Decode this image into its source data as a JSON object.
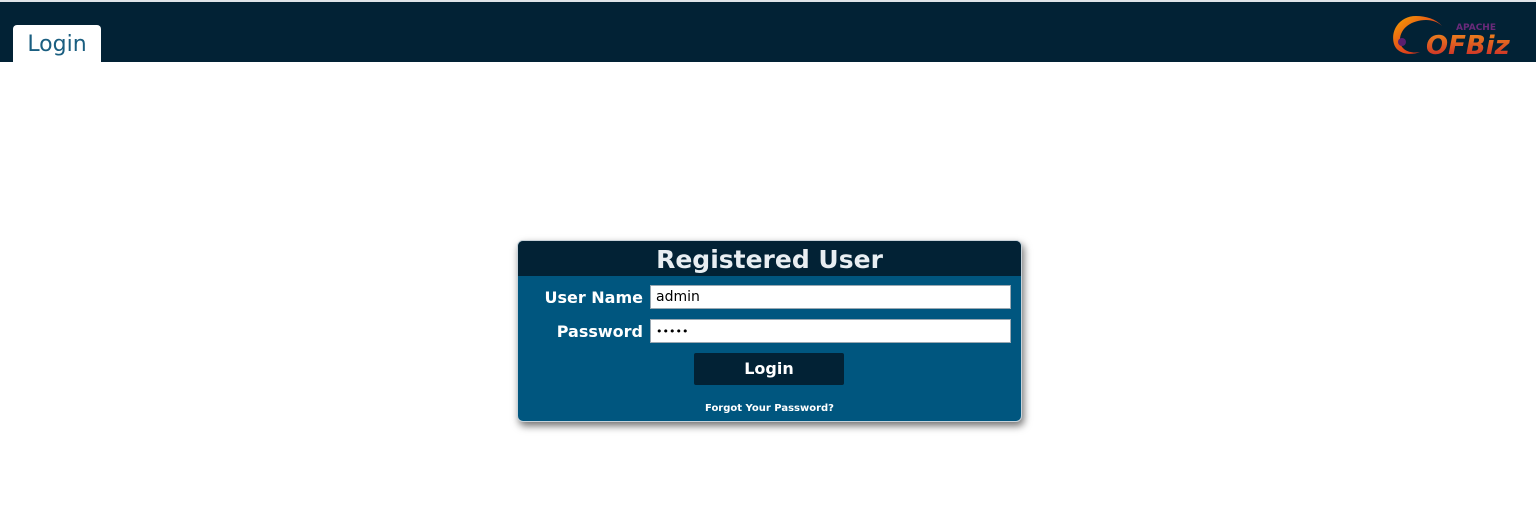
{
  "header": {
    "tab_label": "Login",
    "logo": {
      "small_text": "APACHE",
      "main_text": "OFBiz",
      "icon": "ofbiz-logo-icon"
    },
    "colors": {
      "header_bg": "#022235",
      "tab_text": "#1a5e80"
    }
  },
  "login_panel": {
    "title": "Registered User",
    "username_label": "User Name",
    "username_value": "admin",
    "password_label": "Password",
    "password_value": "•••••",
    "submit_label": "Login",
    "forgot_link": "Forgot Your Password?",
    "colors": {
      "panel_bg": "#00567f",
      "title_bg": "#022235",
      "button_bg": "#022235"
    }
  }
}
